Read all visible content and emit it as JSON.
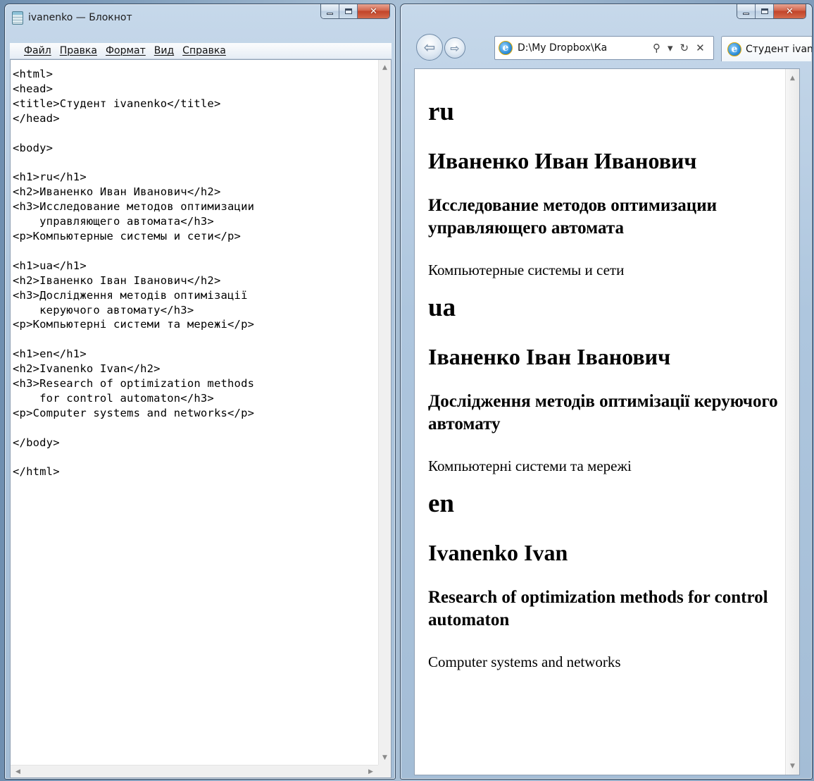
{
  "notepad": {
    "title": "ivanenko — Блокнот",
    "menu": [
      "Файл",
      "Правка",
      "Формат",
      "Вид",
      "Справка"
    ],
    "content": "<html>\n<head>\n<title>Студент ivanenko</title>\n</head>\n\n<body>\n\n<h1>ru</h1>\n<h2>Иваненко Иван Иванович</h2>\n<h3>Исследование методов оптимизации\n    управляющего автомата</h3>\n<p>Компьютерные системы и сети</p>\n\n<h1>ua</h1>\n<h2>Іваненко Іван Іванович</h2>\n<h3>Дослідження методів оптимізації\n    керуючого автомату</h3>\n<p>Компьютерні системи та мережі</p>\n\n<h1>en</h1>\n<h2>Ivanenko Ivan</h2>\n<h3>Research of optimization methods\n    for control automaton</h3>\n<p>Computer systems and networks</p>\n\n</body>\n\n</html>"
  },
  "browser": {
    "address": "D:\\My Dropbox\\Ка",
    "tab_title": "Студент ivanenko",
    "sections": [
      {
        "h1": "ru",
        "h2": "Иваненко Иван Иванович",
        "h3": "Исследование методов оптимизации управляющего автомата",
        "p": "Компьютерные системы и сети"
      },
      {
        "h1": "ua",
        "h2": "Іваненко Іван Іванович",
        "h3": "Дослідження методів оптимізації керуючого автомату",
        "p": "Компьютерні системи та мережі"
      },
      {
        "h1": "en",
        "h2": "Ivanenko Ivan",
        "h3": "Research of optimization methods for control automaton",
        "p": "Computer systems and networks"
      }
    ]
  },
  "icons": {
    "notepad": "notepad-icon",
    "ie": "internet-explorer-icon",
    "back": "back-arrow-icon",
    "forward": "forward-arrow-icon",
    "search": "search-icon",
    "refresh": "refresh-icon",
    "stop": "stop-icon"
  },
  "colors": {
    "desktop": "#8fa9c4",
    "close_button": "#c9492e"
  }
}
